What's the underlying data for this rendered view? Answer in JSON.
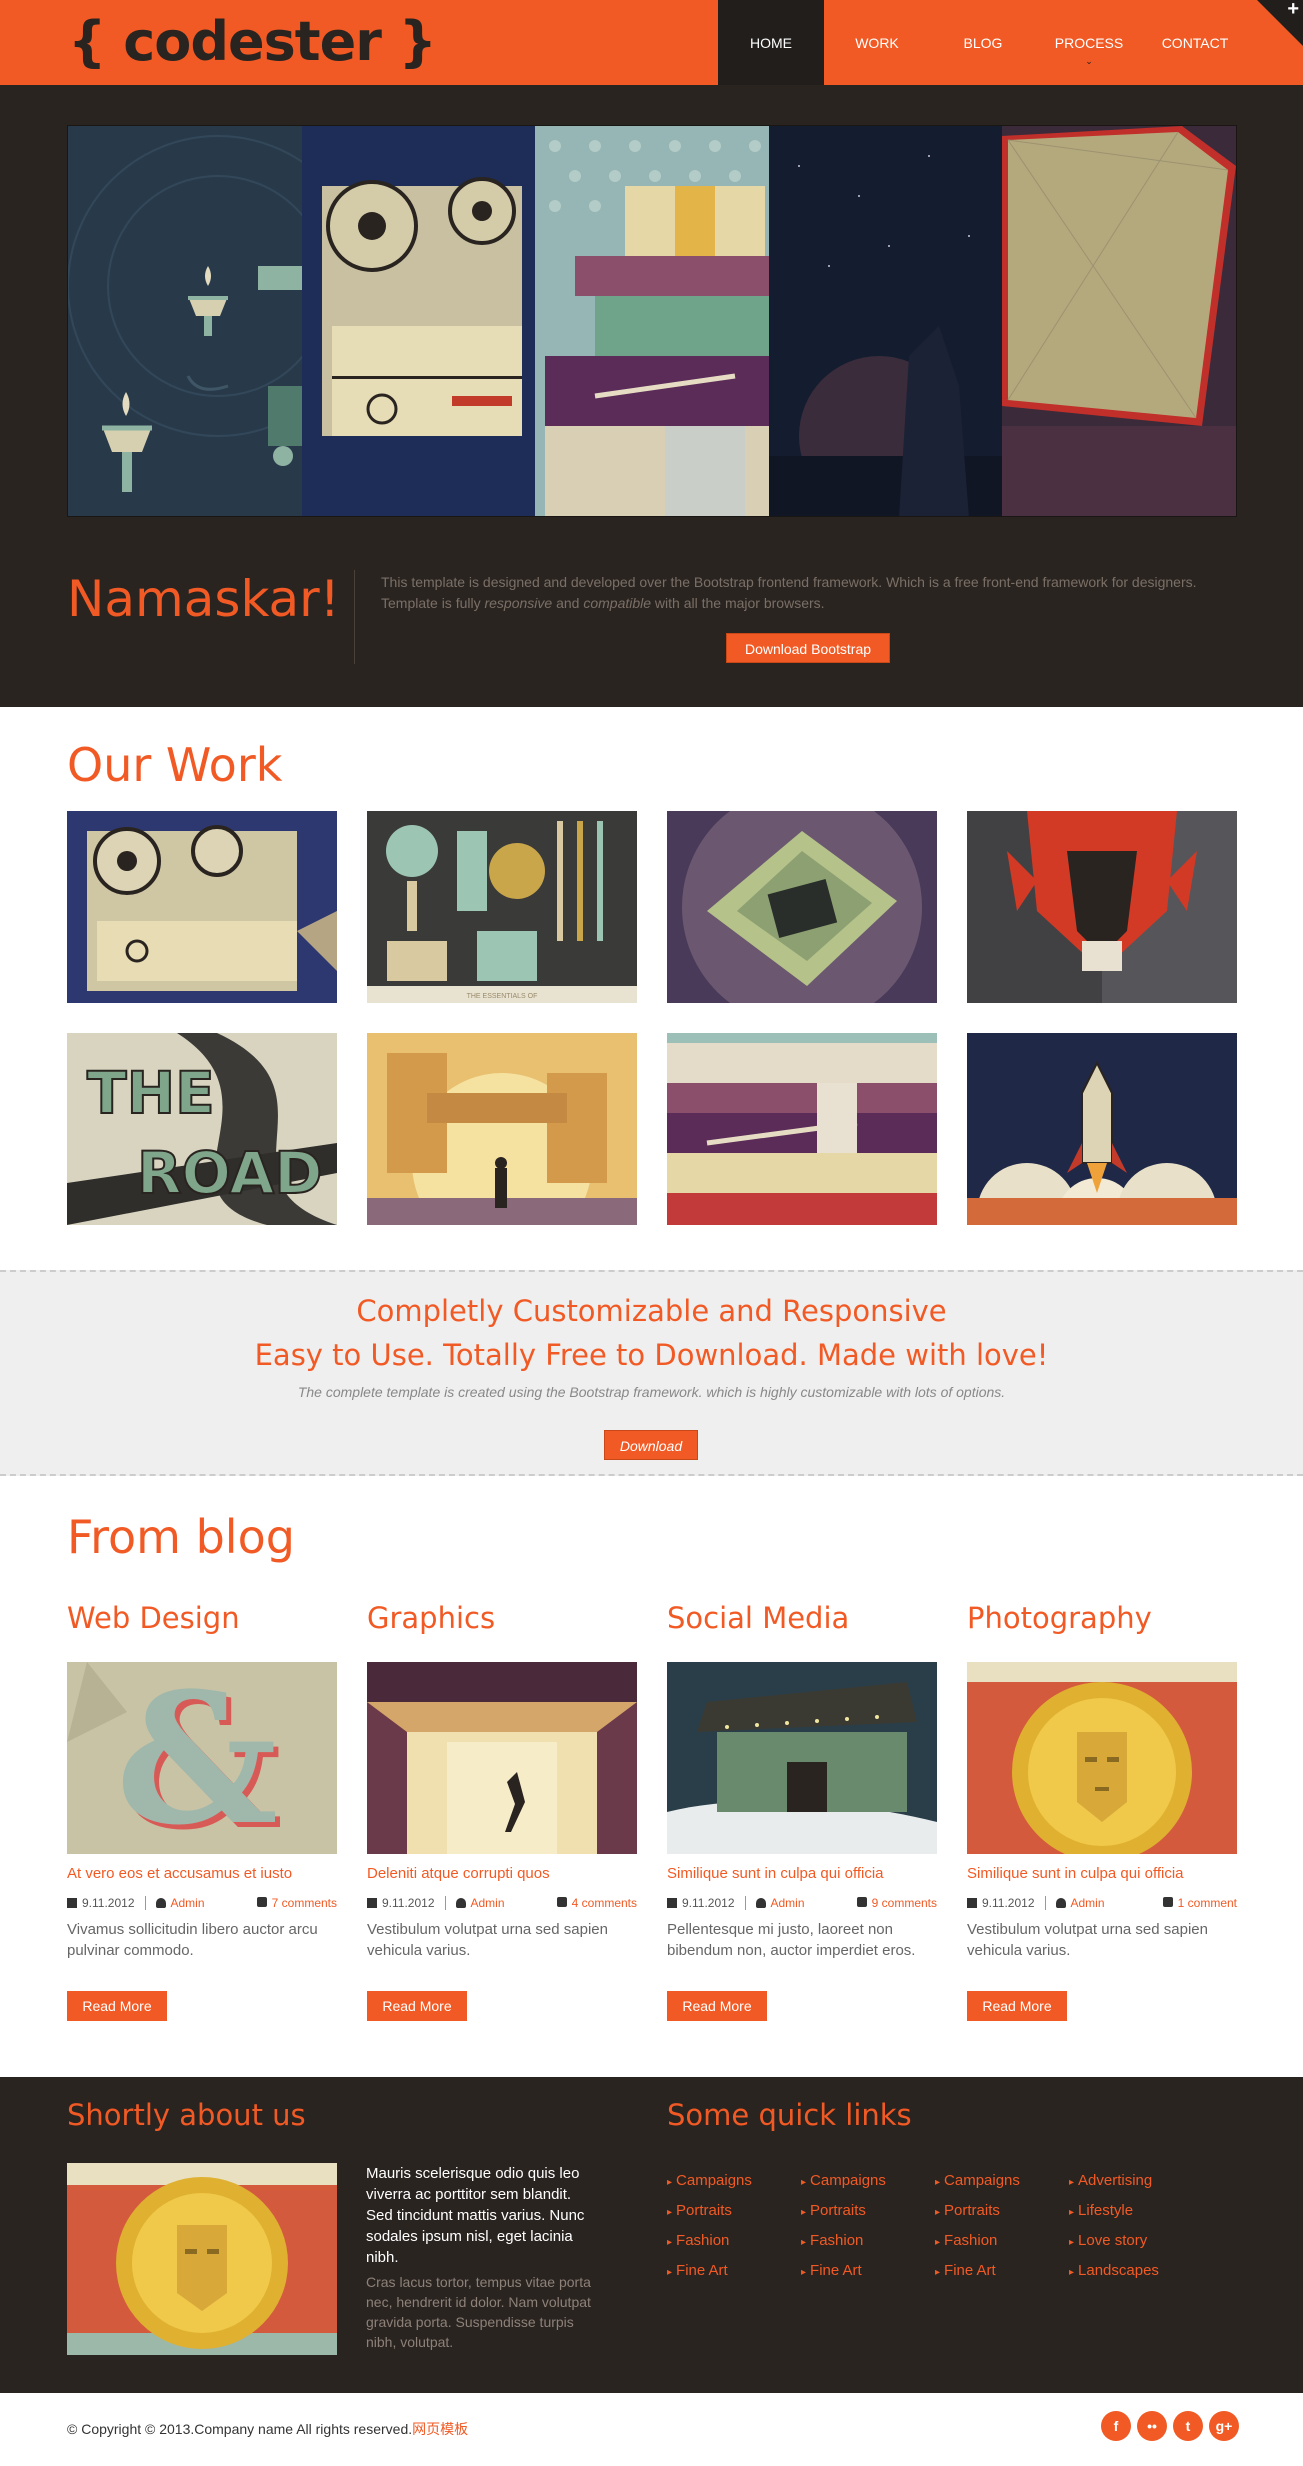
{
  "header": {
    "logo": "{ codester }",
    "nav": [
      {
        "label": "HOME"
      },
      {
        "label": "WORK"
      },
      {
        "label": "BLOG"
      },
      {
        "label": "PROCESS"
      },
      {
        "label": "CONTACT"
      }
    ],
    "process_caret": "⌄",
    "corner_plus": "+"
  },
  "hero": {
    "title_first": "N",
    "title_rest": "amaskar!",
    "text_part1": "This template is designed and developed over the Bootstrap frontend framework. Which is a free front-end framework for designers. Template is fully ",
    "text_em1": "responsive",
    "text_part2": " and ",
    "text_em2": "compatible",
    "text_part3": " with all the major browsers.",
    "button": "Download Bootstrap"
  },
  "work": {
    "title": "Our Work",
    "caption_tile2": "THE ESSENTIALS OF"
  },
  "band": {
    "line1": "Completly Customizable and Responsive",
    "line2": "Easy to Use. Totally Free to Download. Made with love!",
    "subtitle": "The complete template is created using the Bootstrap framework. which is highly customizable with lots of options.",
    "button": "Download"
  },
  "blog": {
    "title": "From blog",
    "posts": [
      {
        "category": "Web Design",
        "title": "At vero eos et accusamus et iusto",
        "date": "9.11.2012",
        "author": "Admin",
        "comments": "7 comments",
        "excerpt": "Vivamus sollicitudin libero auctor arcu pulvinar commodo.",
        "button": "Read More"
      },
      {
        "category": "Graphics",
        "title": "Deleniti atque corrupti quos",
        "date": "9.11.2012",
        "author": "Admin",
        "comments": "4 comments",
        "excerpt": "Vestibulum volutpat urna sed sapien vehicula varius.",
        "button": "Read More"
      },
      {
        "category": "Social Media",
        "title": "Similique sunt in culpa qui officia",
        "date": "9.11.2012",
        "author": "Admin",
        "comments": "9 comments",
        "excerpt": "Pellentesque mi justo, laoreet non bibendum non, auctor imperdiet eros.",
        "button": "Read More"
      },
      {
        "category": "Photography",
        "title": "Similique sunt in culpa qui officia",
        "date": "9.11.2012",
        "author": "Admin",
        "comments": "1 comment",
        "excerpt": "Vestibulum volutpat urna sed sapien vehicula varius.",
        "button": "Read More"
      }
    ]
  },
  "footer": {
    "about_title": "Shortly about us",
    "about_bold": "Mauris scelerisque odio quis leo viverra ac porttitor sem blandit. Sed tincidunt mattis varius. Nunc sodales ipsum nisl, eget lacinia nibh.",
    "about_light": "Cras lacus tortor, tempus vitae porta nec, hendrerit id dolor. Nam volutpat gravida porta. Suspendisse turpis nibh, volutpat.",
    "links_title": "Some quick links",
    "link_columns": [
      [
        "Campaigns",
        "Portraits",
        "Fashion",
        "Fine Art"
      ],
      [
        "Campaigns",
        "Portraits",
        "Fashion",
        "Fine Art"
      ],
      [
        "Campaigns",
        "Portraits",
        "Fashion",
        "Fine Art"
      ],
      [
        "Advertising",
        "Lifestyle",
        "Love story",
        "Landscapes"
      ]
    ],
    "copyright": "© Copyright © 2013.Company name All rights reserved.",
    "copyright_link": "网页模板",
    "social": [
      "facebook-icon",
      "flickr-icon",
      "twitter-icon",
      "google-plus-icon"
    ]
  },
  "colors": {
    "accent": "#f15a24",
    "dark": "#2a2421",
    "nav_active": "#221e1b",
    "band_bg": "#efefef"
  }
}
